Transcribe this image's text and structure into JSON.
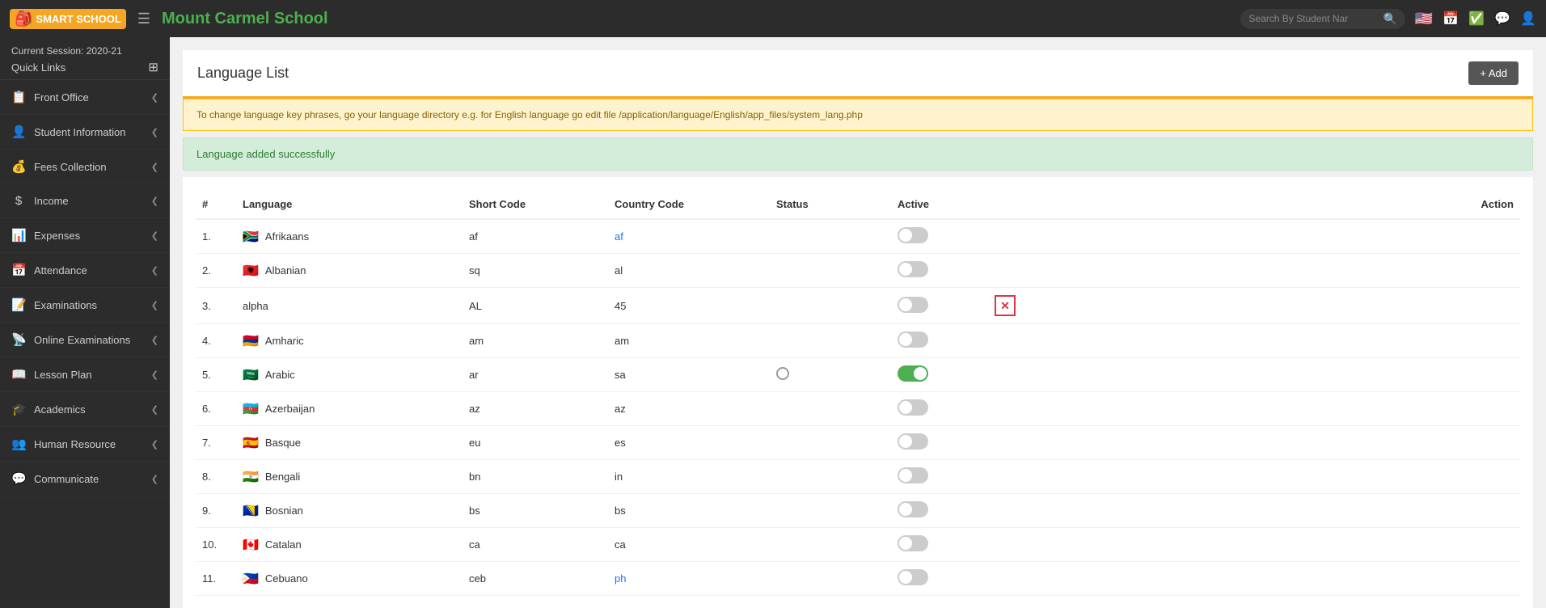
{
  "navbar": {
    "logo_text": "SMART SCHOOL",
    "school_name": "Mount Carmel School",
    "search_placeholder": "Search By Student Nar",
    "hamburger_icon": "☰"
  },
  "sidebar": {
    "session_label": "Current Session: 2020-21",
    "quick_links_label": "Quick Links",
    "items": [
      {
        "id": "front-office",
        "label": "Front Office",
        "icon": "📋"
      },
      {
        "id": "student-information",
        "label": "Student Information",
        "icon": "👤"
      },
      {
        "id": "fees-collection",
        "label": "Fees Collection",
        "icon": "💰"
      },
      {
        "id": "income",
        "label": "Income",
        "icon": "$"
      },
      {
        "id": "expenses",
        "label": "Expenses",
        "icon": "📊"
      },
      {
        "id": "attendance",
        "label": "Attendance",
        "icon": "📅"
      },
      {
        "id": "examinations",
        "label": "Examinations",
        "icon": "📝"
      },
      {
        "id": "online-examinations",
        "label": "Online Examinations",
        "icon": "📡"
      },
      {
        "id": "lesson-plan",
        "label": "Lesson Plan",
        "icon": "📖"
      },
      {
        "id": "academics",
        "label": "Academics",
        "icon": "🎓"
      },
      {
        "id": "human-resource",
        "label": "Human Resource",
        "icon": "👥"
      },
      {
        "id": "communicate",
        "label": "Communicate",
        "icon": "💬"
      }
    ]
  },
  "page": {
    "title": "Language List",
    "add_button_label": "+ Add",
    "alert_warning": "To change language key phrases, go your language directory e.g. for English language go edit file /application/language/English/app_files/system_lang.php",
    "alert_success": "Language added successfully",
    "table": {
      "headers": [
        "#",
        "Language",
        "Short Code",
        "Country Code",
        "Status",
        "Active",
        "Action"
      ],
      "rows": [
        {
          "num": "1.",
          "language": "Afrikaans",
          "flag": "🇿🇦",
          "short_code": "af",
          "country_code": "af",
          "country_link": true,
          "status": "",
          "active": false,
          "has_radio": false,
          "has_delete": false
        },
        {
          "num": "2.",
          "language": "Albanian",
          "flag": "🇦🇱",
          "short_code": "sq",
          "country_code": "al",
          "country_link": false,
          "status": "",
          "active": false,
          "has_radio": false,
          "has_delete": false
        },
        {
          "num": "3.",
          "language": "alpha",
          "flag": "",
          "short_code": "AL",
          "country_code": "45",
          "country_link": false,
          "status": "",
          "active": false,
          "has_radio": false,
          "has_delete": true
        },
        {
          "num": "4.",
          "language": "Amharic",
          "flag": "🇦🇲",
          "short_code": "am",
          "country_code": "am",
          "country_link": false,
          "status": "",
          "active": false,
          "has_radio": false,
          "has_delete": false
        },
        {
          "num": "5.",
          "language": "Arabic",
          "flag": "🇸🇦",
          "short_code": "ar",
          "country_code": "sa",
          "country_link": false,
          "status": "",
          "active": true,
          "has_radio": true,
          "has_delete": false
        },
        {
          "num": "6.",
          "language": "Azerbaijan",
          "flag": "🇦🇿",
          "short_code": "az",
          "country_code": "az",
          "country_link": false,
          "status": "",
          "active": false,
          "has_radio": false,
          "has_delete": false
        },
        {
          "num": "7.",
          "language": "Basque",
          "flag": "🇪🇸",
          "short_code": "eu",
          "country_code": "es",
          "country_link": false,
          "status": "",
          "active": false,
          "has_radio": false,
          "has_delete": false
        },
        {
          "num": "8.",
          "language": "Bengali",
          "flag": "🇮🇳",
          "short_code": "bn",
          "country_code": "in",
          "country_link": false,
          "status": "",
          "active": false,
          "has_radio": false,
          "has_delete": false
        },
        {
          "num": "9.",
          "language": "Bosnian",
          "flag": "🇧🇦",
          "short_code": "bs",
          "country_code": "bs",
          "country_link": false,
          "status": "",
          "active": false,
          "has_radio": false,
          "has_delete": false
        },
        {
          "num": "10.",
          "language": "Catalan",
          "flag": "🇨🇦",
          "short_code": "ca",
          "country_code": "ca",
          "country_link": false,
          "status": "",
          "active": false,
          "has_radio": false,
          "has_delete": false
        },
        {
          "num": "11.",
          "language": "Cebuano",
          "flag": "🇵🇭",
          "short_code": "ceb",
          "country_code": "ph",
          "country_link": true,
          "status": "",
          "active": false,
          "has_radio": false,
          "has_delete": false
        }
      ]
    }
  }
}
